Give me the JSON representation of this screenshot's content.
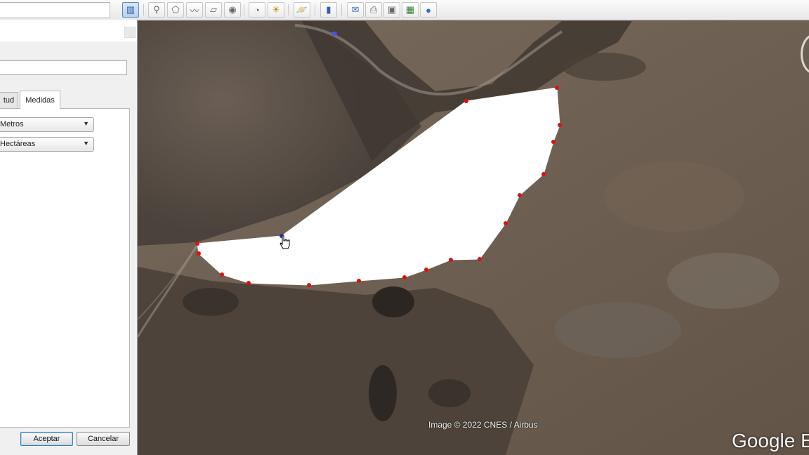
{
  "toolbar": {
    "icons": [
      "sidebar-toggle-icon",
      "add-placemark-icon",
      "add-polygon-icon",
      "add-path-icon",
      "add-image-overlay-icon",
      "record-tour-icon",
      "historical-imagery-icon",
      "sunlight-icon",
      "switch-to-sky-icon",
      "ruler-icon",
      "email-icon",
      "print-icon",
      "save-image-icon",
      "view-in-maps-icon",
      "earth-icon"
    ]
  },
  "dialog": {
    "tabs": [
      {
        "label": "tud"
      },
      {
        "label": "Medidas"
      }
    ],
    "length_unit": "Metros",
    "area_unit": "Hectáreas",
    "ok_label": "Aceptar",
    "cancel_label": "Cancelar"
  },
  "map": {
    "attribution": "Image © 2022 CNES / Airbus",
    "logo": "Google Earth",
    "polygon_fill": "#ffffff",
    "vertex_color": "#e01010",
    "active_vertex_color": "#2233cc"
  }
}
